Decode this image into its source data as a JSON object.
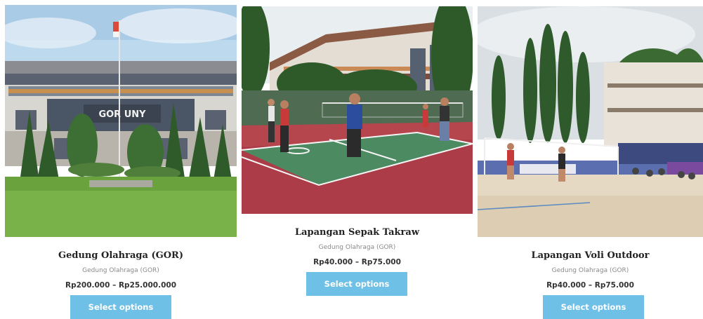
{
  "products": [
    {
      "title": "Gedung Olahraga (GOR)",
      "category": "Gedung Olahraga (GOR)",
      "price": "Rp200.000 – Rp25.000.000",
      "button_label": "Select options",
      "sign_text": "GOR UNY"
    },
    {
      "title": "Lapangan Sepak Takraw",
      "category": "Gedung Olahraga (GOR)",
      "price": "Rp40.000 – Rp75.000",
      "button_label": "Select options"
    },
    {
      "title": "Lapangan Voli Outdoor",
      "category": "Gedung Olahraga (GOR)",
      "price": "Rp40.000 – Rp75.000",
      "button_label": "Select options"
    }
  ],
  "colors": {
    "button_bg": "#6ec0e6",
    "button_text": "#ffffff",
    "title": "#222222",
    "category": "#8a8a8a",
    "price": "#333333"
  }
}
